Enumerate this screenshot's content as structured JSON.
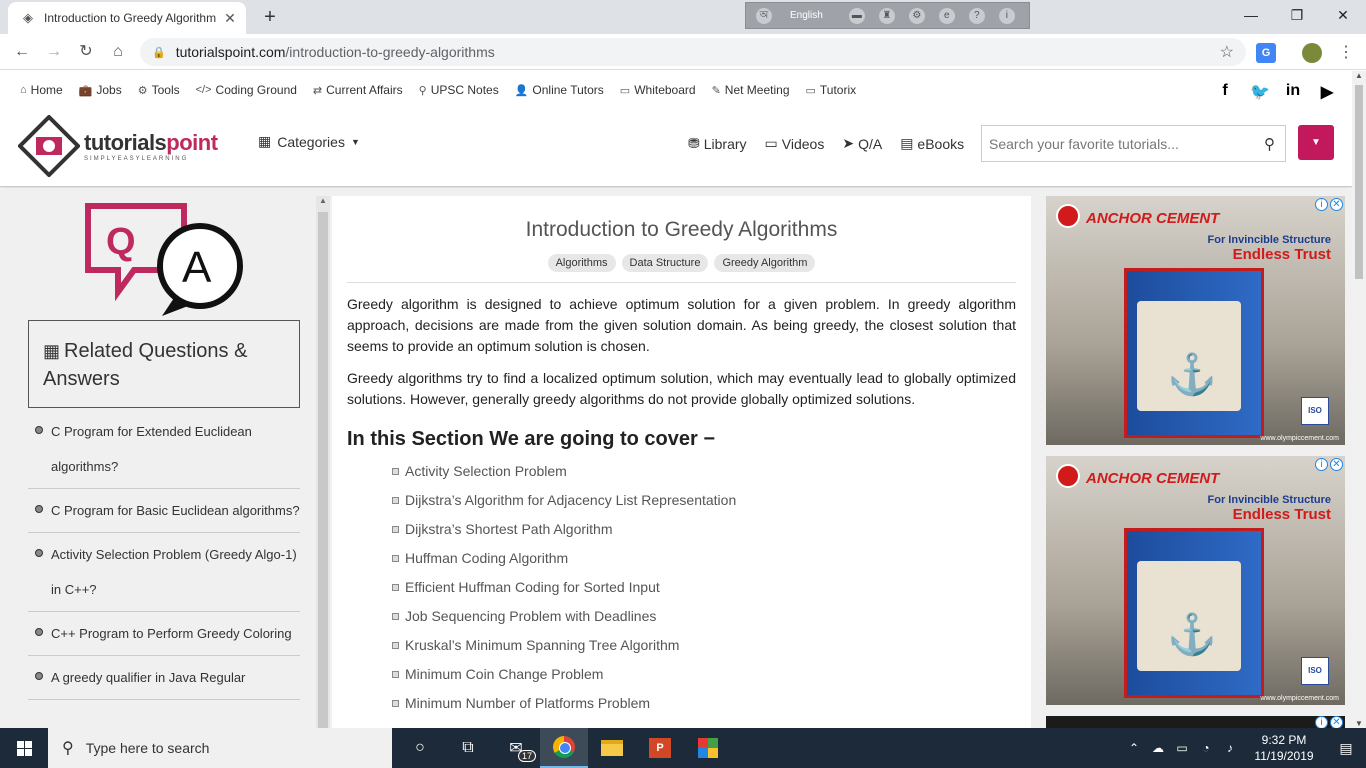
{
  "browser": {
    "tab_title": "Introduction to Greedy Algorithm",
    "new_tab": "+",
    "language": "English",
    "url_host": "tutorialspoint.com",
    "url_path": "/introduction-to-greedy-algorithms",
    "win_min": "—",
    "win_max": "❐",
    "win_close": "✕"
  },
  "toplinks": [
    {
      "label": "Home",
      "icon": "⌂"
    },
    {
      "label": "Jobs",
      "icon": "💼"
    },
    {
      "label": "Tools",
      "icon": "⚙"
    },
    {
      "label": "Coding Ground",
      "icon": "</>"
    },
    {
      "label": "Current Affairs",
      "icon": "⇄"
    },
    {
      "label": "UPSC Notes",
      "icon": "⚲"
    },
    {
      "label": "Online Tutors",
      "icon": "👤"
    },
    {
      "label": "Whiteboard",
      "icon": "▭"
    },
    {
      "label": "Net Meeting",
      "icon": "✎"
    },
    {
      "label": "Tutorix",
      "icon": "▭"
    }
  ],
  "header": {
    "logo_name_a": "tutorials",
    "logo_name_b": "point",
    "logo_tag": "SIMPLYEASYLEARNING",
    "categories": "Categories",
    "nav": [
      {
        "label": "Library",
        "icon": "⛃"
      },
      {
        "label": "Videos",
        "icon": "▭"
      },
      {
        "label": "Q/A",
        "icon": "➤"
      },
      {
        "label": "eBooks",
        "icon": "▤"
      }
    ],
    "search_placeholder": "Search your favorite tutorials..."
  },
  "sidebar": {
    "related_title": "Related Questions & Answers",
    "items": [
      "C Program for Extended Euclidean algorithms?",
      "C Program for Basic Euclidean algorithms?",
      "Activity Selection Problem (Greedy Algo-1) in C++?",
      "C++ Program to Perform Greedy Coloring",
      "A greedy qualifier in Java Regular"
    ]
  },
  "article": {
    "title": "Introduction to Greedy Algorithms",
    "tags": [
      "Algorithms",
      "Data Structure",
      "Greedy Algorithm"
    ],
    "para1": "Greedy algorithm is designed to achieve optimum solution for a given problem. In greedy algorithm approach, decisions are made from the given solution domain. As being greedy, the closest solution that seems to provide an optimum solution is chosen.",
    "para2": "Greedy algorithms try to find a localized optimum solution, which may eventually lead to globally optimized solutions. However, generally greedy algorithms do not provide globally optimized solutions.",
    "section_heading": "In this Section We are going to cover −",
    "topics": [
      "Activity Selection Problem",
      "Dijkstra’s Algorithm for Adjacency List Representation",
      "Dijkstra’s Shortest Path Algorithm",
      "Huffman Coding Algorithm",
      "Efficient Huffman Coding for Sorted Input",
      "Job Sequencing Problem with Deadlines",
      "Kruskal’s Minimum Spanning Tree Algorithm",
      "Minimum Coin Change Problem",
      "Minimum Number of Platforms Problem"
    ]
  },
  "ads": {
    "brand": "ANCHOR CEMENT",
    "slogan1": "For Invincible Structure",
    "slogan2": "Endless Trust",
    "iso": "ISO",
    "url": "www.olympiccement.com"
  },
  "taskbar": {
    "search_placeholder": "Type here to search",
    "mail_badge": "17",
    "time": "9:32 PM",
    "date": "11/19/2019"
  },
  "colors": {
    "brand_accent": "#c1195b",
    "taskbar_bg": "#1c2a3a"
  }
}
